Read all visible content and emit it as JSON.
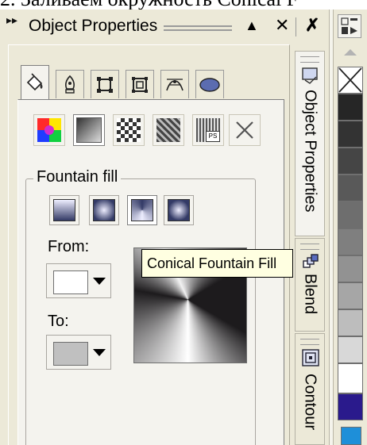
{
  "caption": "2. Заливаем окружность Conical F",
  "docker": {
    "title": "Object Properties",
    "grip_icon": "double-right-arrow-icon",
    "buttons": [
      "collapse-up-icon",
      "close-icon",
      "close-bold-icon"
    ]
  },
  "tabs": [
    {
      "name": "fill",
      "icon": "paint-bucket-icon",
      "active": true
    },
    {
      "name": "outline",
      "icon": "pen-nib-icon",
      "active": false
    },
    {
      "name": "general",
      "icon": "frame-icon",
      "active": false
    },
    {
      "name": "detail",
      "icon": "double-frame-icon",
      "active": false
    },
    {
      "name": "bitmap",
      "icon": "curve-icon",
      "active": false
    },
    {
      "name": "ellipse",
      "icon": "ellipse-icon",
      "active": false
    }
  ],
  "fill_types": [
    {
      "name": "uniform",
      "icon": "color-square-icon",
      "active": false
    },
    {
      "name": "fountain",
      "icon": "gradient-square-icon",
      "active": true
    },
    {
      "name": "pattern",
      "icon": "checker-pattern-icon",
      "active": false
    },
    {
      "name": "texture",
      "icon": "texture-icon",
      "active": false
    },
    {
      "name": "postscript",
      "icon": "ps-icon",
      "active": false
    },
    {
      "name": "none",
      "icon": "x-icon",
      "active": false
    }
  ],
  "fountain": {
    "label": "Fountain fill",
    "styles": [
      {
        "name": "linear",
        "active": false
      },
      {
        "name": "radial",
        "active": false
      },
      {
        "name": "conical",
        "active": true
      },
      {
        "name": "square",
        "active": false
      }
    ],
    "from_label": "From:",
    "from_color": "#ffffff",
    "to_label": "To:",
    "to_color": "#c0c0c0",
    "tooltip": "Conical Fountain Fill"
  },
  "side_tabs": [
    {
      "label": "Object Properties",
      "icon": "object-properties-icon",
      "active": true
    },
    {
      "label": "Blend",
      "icon": "blend-icon",
      "active": false
    },
    {
      "label": "Contour",
      "icon": "contour-icon",
      "active": false
    }
  ],
  "palette": {
    "swatches": [
      "none",
      "#262626",
      "#333333",
      "#454545",
      "#595959",
      "#6e6e6e",
      "#7f7f7f",
      "#929292",
      "#a6a6a6",
      "#bdbdbd",
      "#d8d8d8",
      "#ffffff",
      "#2a1a8c",
      "#1e8fd9"
    ]
  }
}
